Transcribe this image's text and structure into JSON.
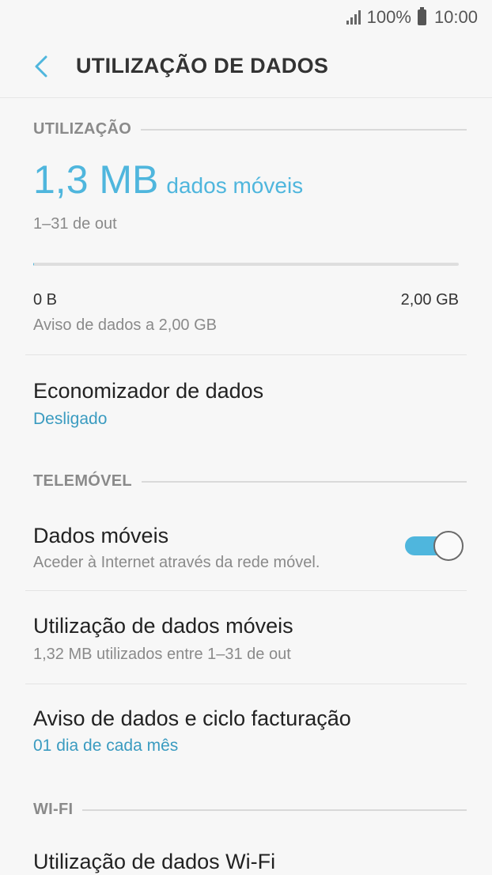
{
  "status_bar": {
    "battery": "100%",
    "time": "10:00"
  },
  "header": {
    "title": "UTILIZAÇÃO DE DADOS"
  },
  "usage": {
    "section_label": "UTILIZAÇÃO",
    "value": "1,3 MB",
    "unit_label": "dados móveis",
    "period": "1–31 de out",
    "bar_min": "0 B",
    "bar_max": "2,00 GB",
    "bar_fill_fraction": 0.0006,
    "warning": "Aviso de dados a 2,00 GB"
  },
  "data_saver": {
    "title": "Economizador de dados",
    "status": "Desligado"
  },
  "mobile": {
    "section_label": "TELEMÓVEL",
    "mobile_data_title": "Dados móveis",
    "mobile_data_sub": "Aceder à Internet através da rede móvel.",
    "mobile_data_enabled": true,
    "usage_title": "Utilização de dados móveis",
    "usage_sub": "1,32 MB utilizados entre 1–31 de out",
    "billing_title": "Aviso de dados e ciclo facturação",
    "billing_sub": "01 dia de cada mês"
  },
  "wifi": {
    "section_label": "WI-FI",
    "usage_title": "Utilização de dados Wi-Fi"
  },
  "colors": {
    "accent": "#4fb6dd",
    "link": "#3a9bc0",
    "background": "#f7f7f7"
  }
}
